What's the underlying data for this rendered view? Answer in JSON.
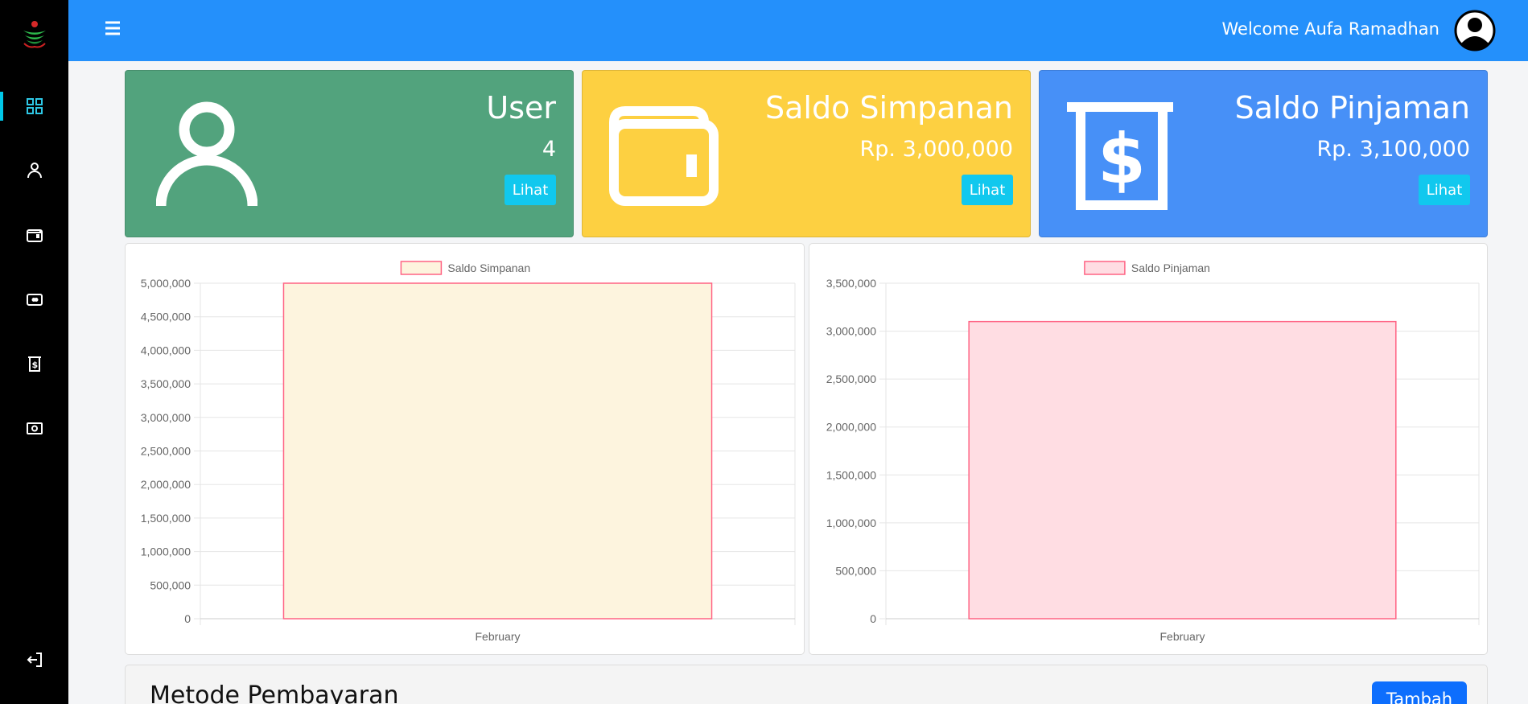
{
  "topbar": {
    "welcome": "Welcome Aufa Ramadhan"
  },
  "sidebar": {
    "items": [
      {
        "icon": "dashboard-grid-icon",
        "active": true
      },
      {
        "icon": "user-icon"
      },
      {
        "icon": "wallet-icon"
      },
      {
        "icon": "card-icon"
      },
      {
        "icon": "atm-dollar-icon"
      },
      {
        "icon": "cash-icon"
      },
      {
        "icon": "logout-icon"
      }
    ]
  },
  "cards": [
    {
      "title": "User",
      "value": "4",
      "button": "Lihat",
      "color": "#52a37d"
    },
    {
      "title": "Saldo Simpanan",
      "value": "Rp. 3,000,000",
      "button": "Lihat",
      "color": "#fdd041"
    },
    {
      "title": "Saldo Pinjaman",
      "value": "Rp. 3,100,000",
      "button": "Lihat",
      "color": "#4790f7"
    }
  ],
  "section": {
    "title": "Metode Pembayaran",
    "button": "Tambah"
  },
  "chart_data": [
    {
      "type": "bar",
      "categories": [
        "February"
      ],
      "series": [
        {
          "name": "Saldo Simpanan",
          "values": [
            5000000
          ],
          "fill": "#fdf4de",
          "stroke": "#ff6384"
        }
      ],
      "ylim": [
        0,
        5000000
      ],
      "yticks": [
        0,
        500000,
        1000000,
        1500000,
        2000000,
        2500000,
        3000000,
        3500000,
        4000000,
        4500000,
        5000000
      ],
      "legend": "top",
      "grid": true
    },
    {
      "type": "bar",
      "categories": [
        "February"
      ],
      "series": [
        {
          "name": "Saldo Pinjaman",
          "values": [
            3100000
          ],
          "fill": "#ffdde3",
          "stroke": "#ff6384"
        }
      ],
      "ylim": [
        0,
        3500000
      ],
      "yticks": [
        0,
        500000,
        1000000,
        1500000,
        2000000,
        2500000,
        3000000,
        3500000
      ],
      "legend": "top",
      "grid": true
    }
  ]
}
